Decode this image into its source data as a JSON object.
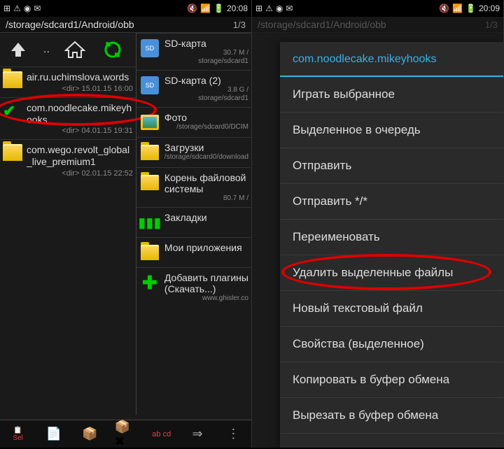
{
  "status": {
    "time_left": "20:08",
    "time_right": "20:09"
  },
  "path": {
    "text": "/storage/sdcard1/Android/obb",
    "count": "1/3"
  },
  "up_label": "..",
  "left_files": [
    {
      "name": "air.ru.uchimslova.words",
      "meta": "<dir>  15.01.15  16:00",
      "selected": false
    },
    {
      "name": "com.noodlecake.mikeyhooks",
      "meta": "<dir>  04.01.15  19:31",
      "selected": true
    },
    {
      "name": "com.wego.revolt_global_live_premium1",
      "meta": "<dir>  02.01.15  22:52",
      "selected": false
    }
  ],
  "right_items": [
    {
      "title": "SD-карта",
      "meta1": "30.7 M /",
      "meta2": "storage/sdcard1",
      "icon": "sd"
    },
    {
      "title": "SD-карта (2)",
      "meta1": "3.8 G /",
      "meta2": "storage/sdcard1",
      "icon": "sd"
    },
    {
      "title": "Фото",
      "meta1": "",
      "meta2": "/storage/sdcard0/DCIM",
      "icon": "photo"
    },
    {
      "title": "Загрузки",
      "meta1": "",
      "meta2": "/storage/sdcard0/download",
      "icon": "folder"
    },
    {
      "title": "Корень файловой системы",
      "meta1": "80.7 M /",
      "meta2": "",
      "icon": "folder"
    },
    {
      "title": "Закладки",
      "meta1": "",
      "meta2": "",
      "icon": "bookmark"
    },
    {
      "title": "Мои приложения",
      "meta1": "",
      "meta2": "",
      "icon": "apps"
    },
    {
      "title": "Добавить плагины (Скачать...)",
      "meta1": "",
      "meta2": "www.ghisler.co",
      "icon": "plus"
    }
  ],
  "menu": {
    "header": "com.noodlecake.mikeyhooks",
    "items": [
      "Играть выбранное",
      "Выделенное в очередь",
      "Отправить",
      "Отправить */*",
      "Переименовать",
      "Удалить выделенные файлы",
      "Новый текстовый файл",
      "Свойства (выделенное)",
      "Копировать в буфер обмена",
      "Вырезать в буфер обмена"
    ]
  },
  "bottom_labels": {
    "sel": "Sel",
    "abcd": "ab cd"
  }
}
